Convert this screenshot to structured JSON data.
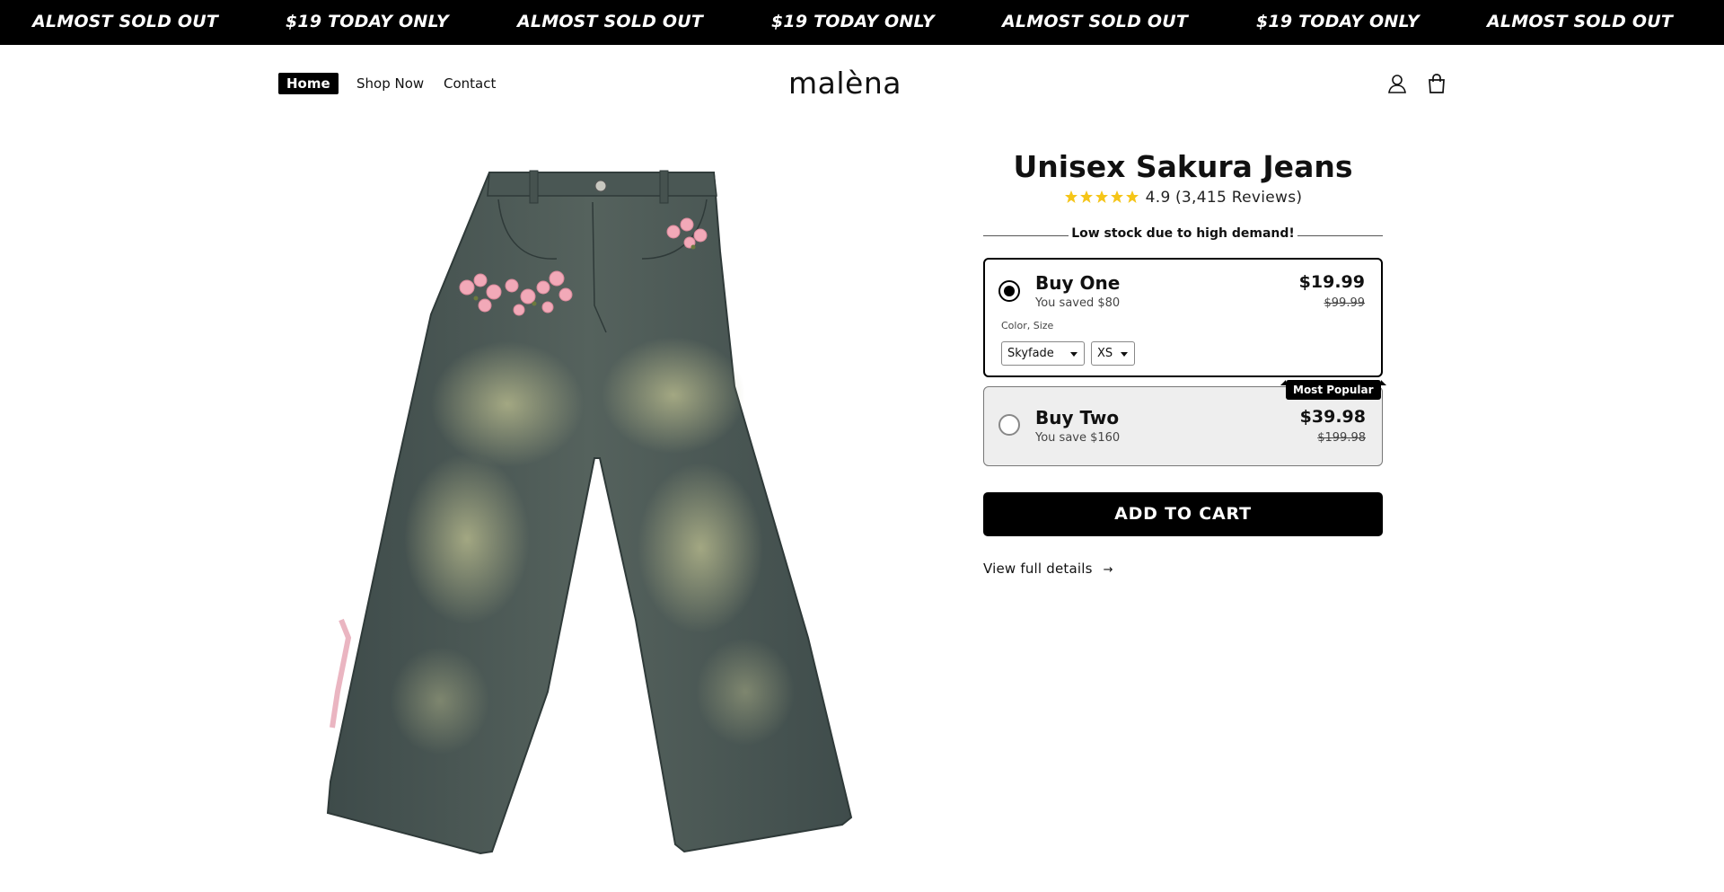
{
  "announcement": {
    "items": [
      "ALMOST SOLD OUT",
      "$19 TODAY ONLY",
      "ALMOST SOLD OUT",
      "$19 TODAY ONLY",
      "ALMOST SOLD OUT",
      "$19 TODAY ONLY",
      "ALMOST SOLD OUT"
    ]
  },
  "header": {
    "nav": [
      {
        "label": "Home",
        "active": true
      },
      {
        "label": "Shop Now",
        "active": false
      },
      {
        "label": "Contact",
        "active": false
      }
    ],
    "logo": "malèna",
    "icons": [
      "account-icon",
      "cart-icon"
    ]
  },
  "product": {
    "title": "Unisex Sakura Jeans",
    "rating": "4.9",
    "reviews": "(3,415 Reviews)",
    "stars": 5,
    "stock_notice": "Low stock due to high demand!",
    "offers": [
      {
        "name": "Buy One",
        "subtext": "You saved $80",
        "price": "$19.99",
        "old_price": "$99.99",
        "selected": true,
        "variant_label": "Color, Size",
        "color_value": "Skyfade",
        "size_value": "XS"
      },
      {
        "name": "Buy Two",
        "subtext": "You save $160",
        "price": "$39.98",
        "old_price": "$199.98",
        "selected": false,
        "badge": "Most Popular"
      }
    ],
    "add_to_cart": "ADD TO CART",
    "details_link": "View full details",
    "details_arrow": "→"
  },
  "colors": {
    "bar_bg": "#000000",
    "star": "#f5c518",
    "denim": "#4e5c5a",
    "blossom": "#f2a9b8"
  }
}
